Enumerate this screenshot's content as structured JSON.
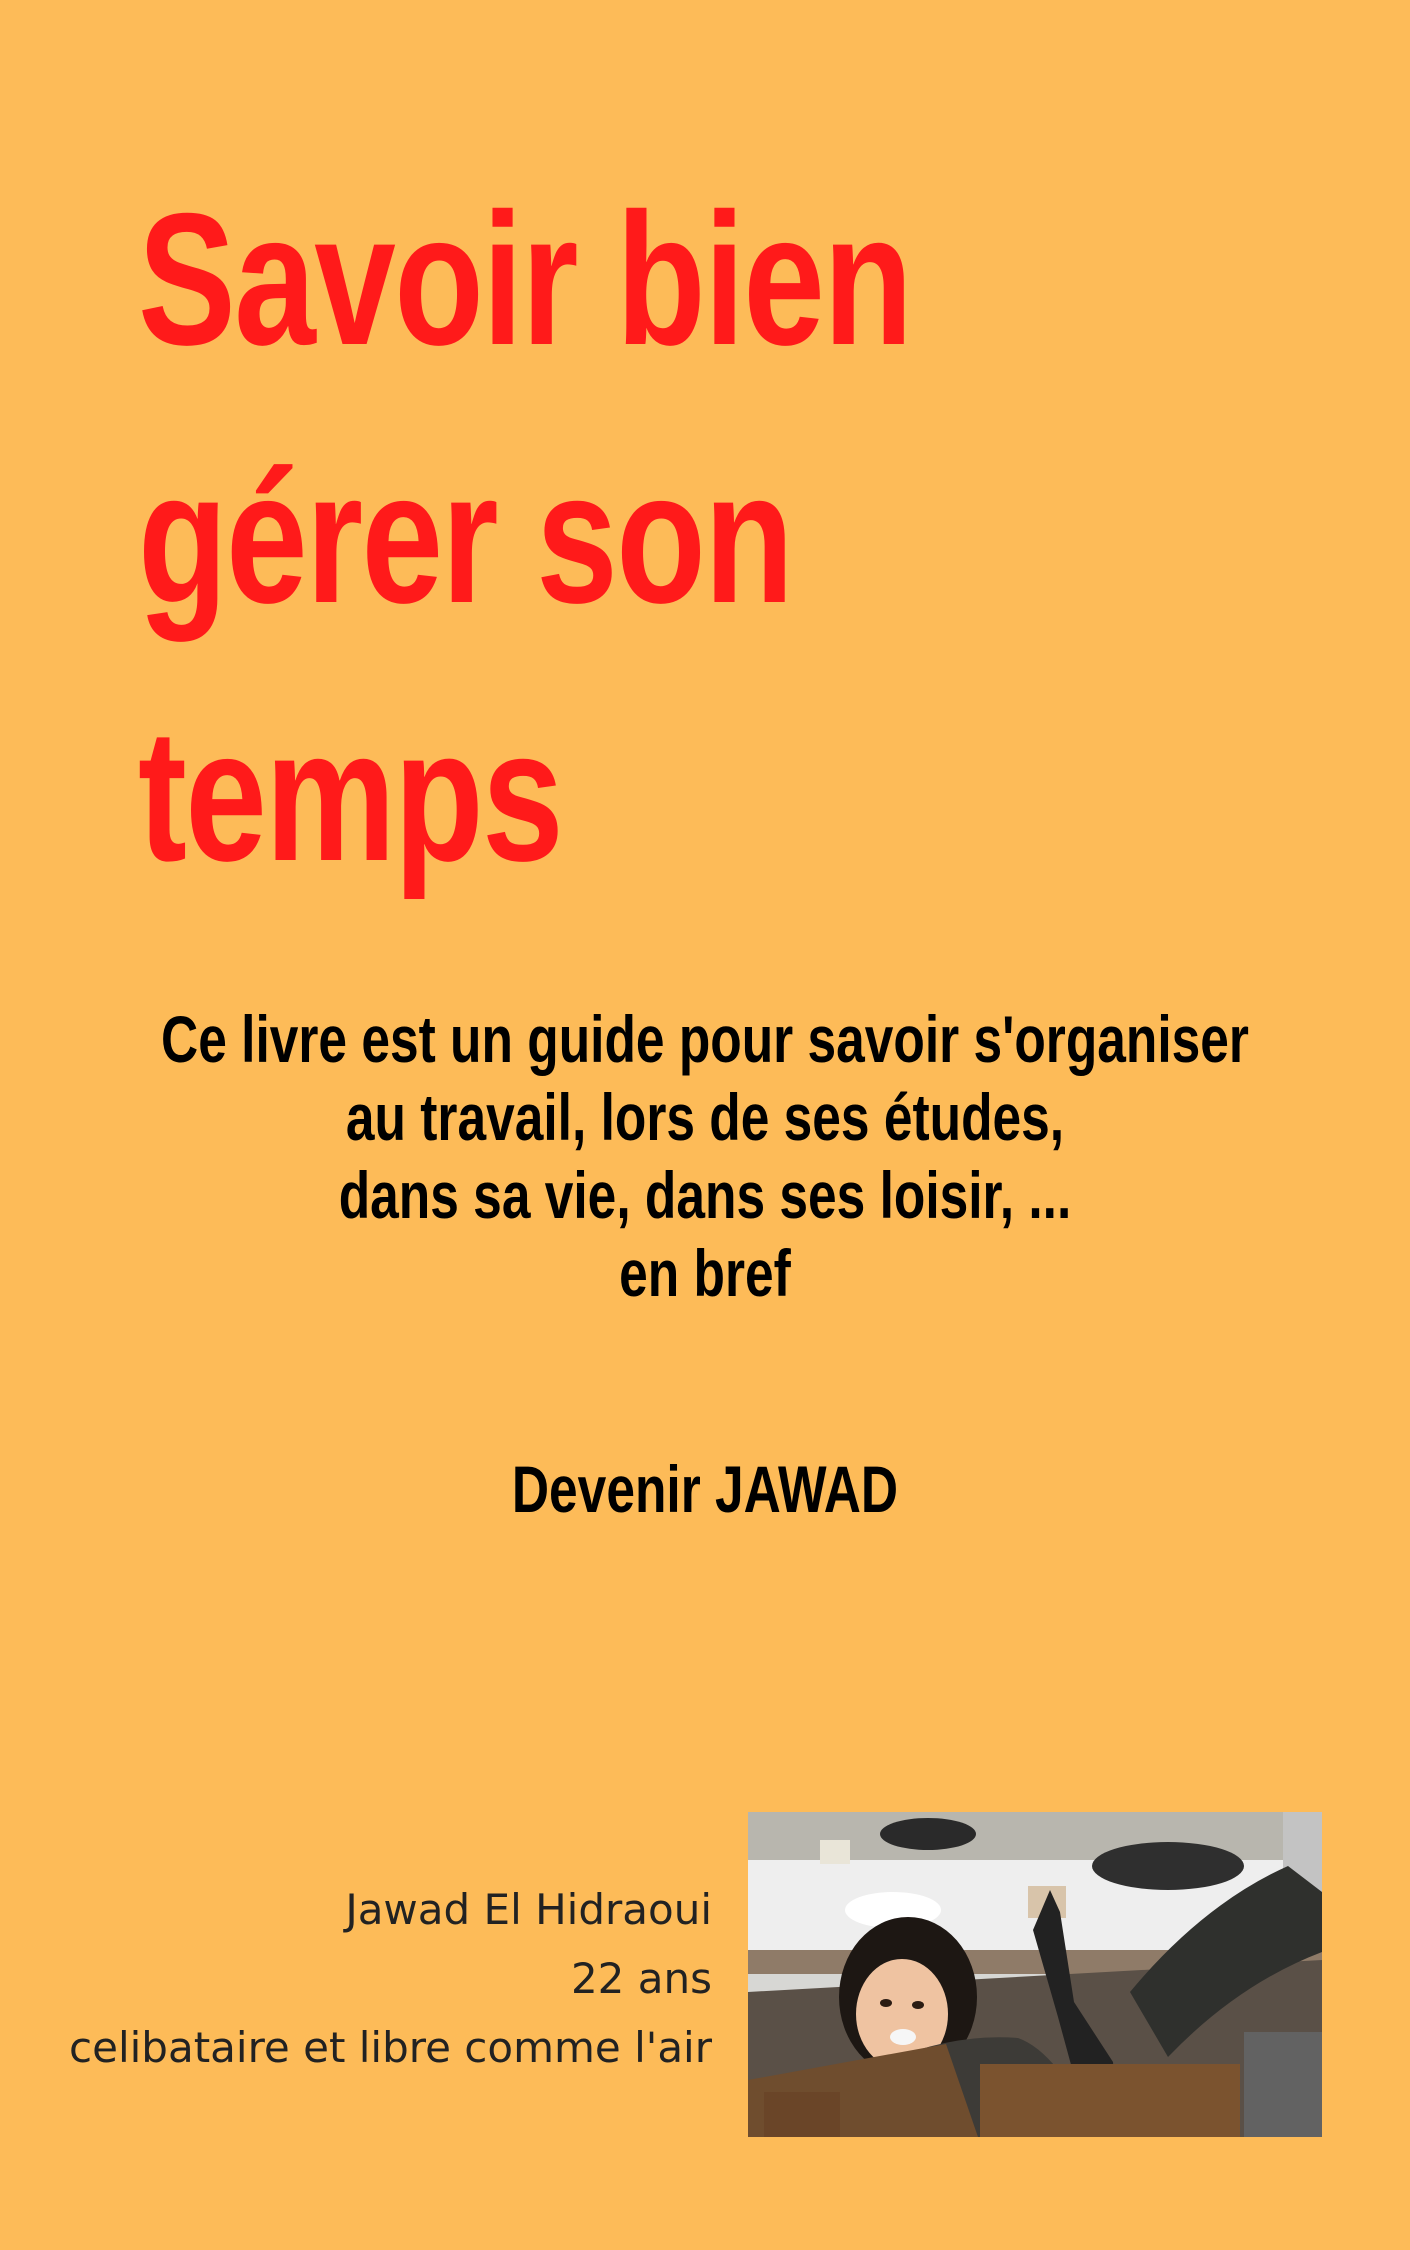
{
  "cover": {
    "background_color": "#FDBB58",
    "title_color": "#FF1A1A",
    "title_lines": [
      "Savoir bien",
      "gérer son",
      "temps"
    ],
    "description_lines": [
      "Ce livre est un guide pour savoir s'organiser",
      "au travail, lors de ses études,",
      "dans sa vie, dans ses loisir, ...",
      "en bref"
    ],
    "tagline": "Devenir JAWAD",
    "author": {
      "name": "Jawad El Hidraoui",
      "age": "22 ans",
      "status": "celibataire et libre comme l'air"
    }
  }
}
